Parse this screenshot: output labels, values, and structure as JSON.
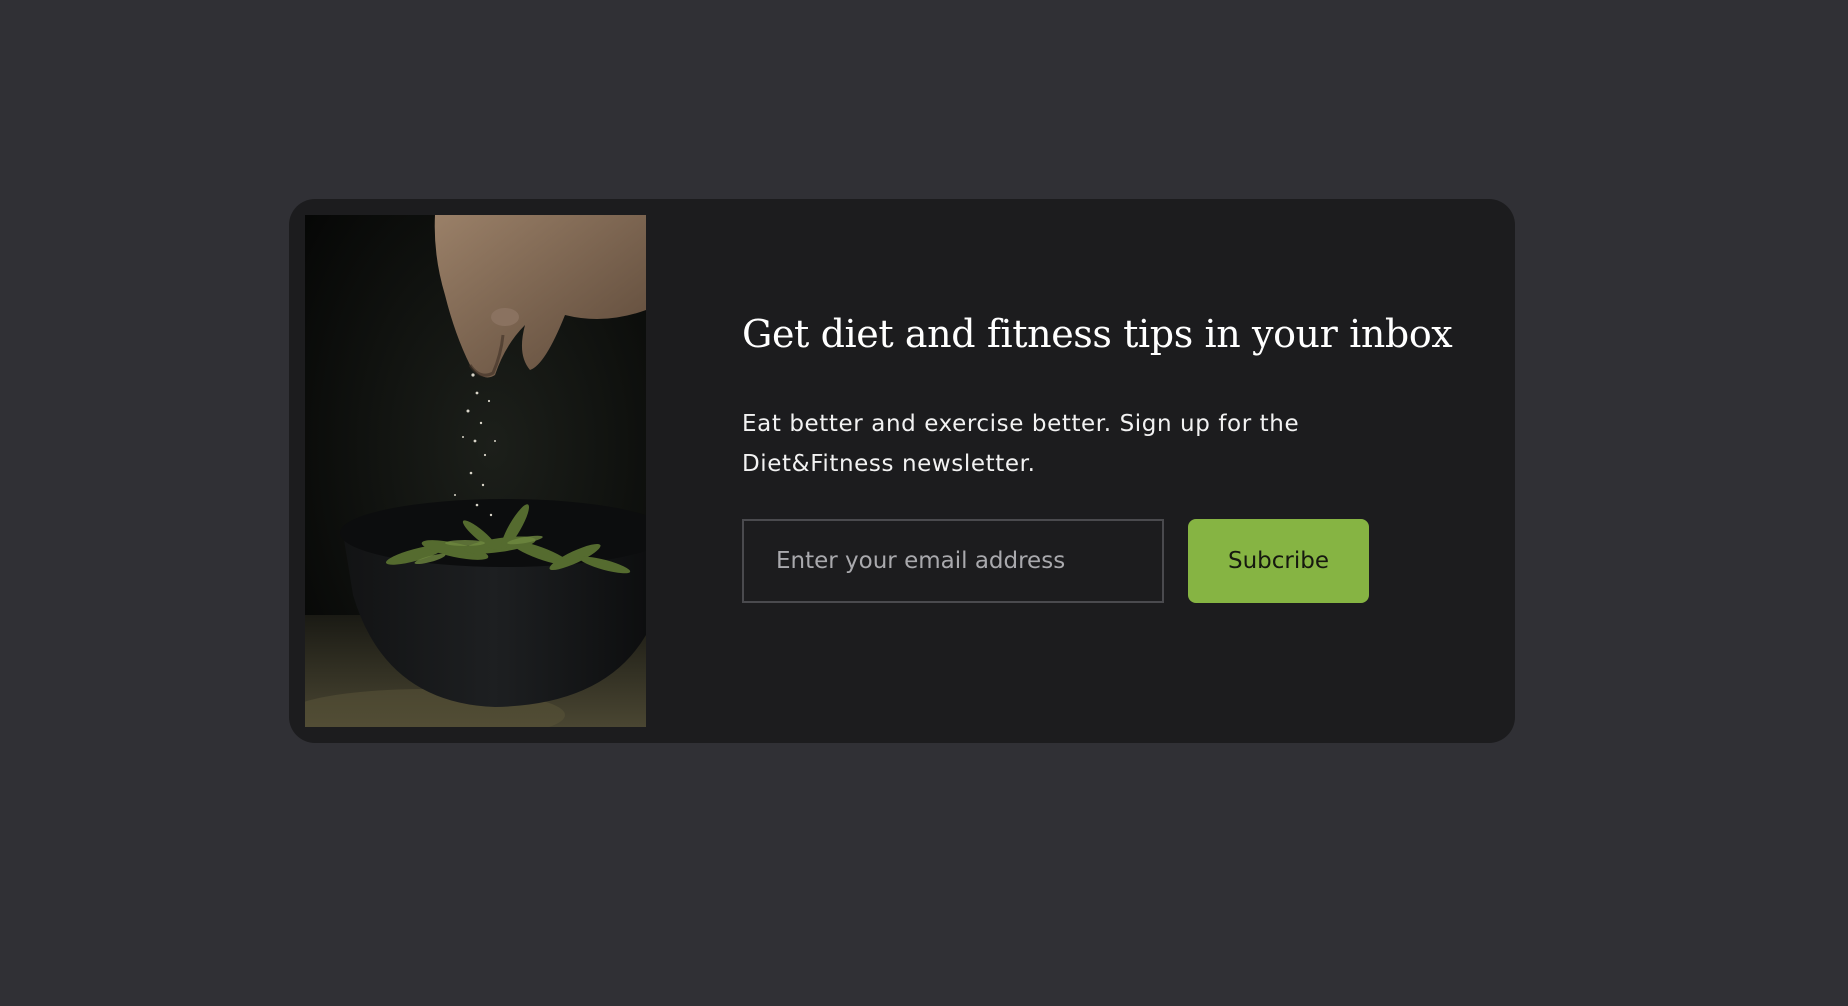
{
  "newsletter": {
    "headline": "Get diet and fitness tips in your inbox",
    "description": "Eat better and exercise better. Sign up for the Diet&Fitness newsletter.",
    "email_placeholder": "Enter your email address",
    "email_value": "",
    "subscribe_label": "Subcribe"
  },
  "colors": {
    "page_background": "#303035",
    "card_background": "#1c1c1e",
    "accent_button": "#86b443",
    "headline_text": "#ffffff"
  },
  "photo": {
    "subject": "hand sprinkling salt over a bowl of green beans"
  }
}
